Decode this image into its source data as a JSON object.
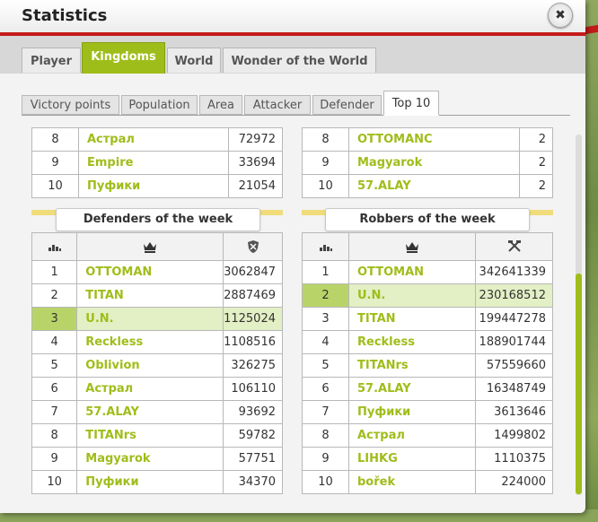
{
  "window": {
    "title": "Statistics",
    "close_symbol": "✖"
  },
  "main_tabs": [
    {
      "label": "Player",
      "active": false
    },
    {
      "label": "Kingdoms",
      "active": true
    },
    {
      "label": "World",
      "active": false
    },
    {
      "label": "Wonder of the World",
      "active": false
    }
  ],
  "sub_tabs": [
    {
      "label": "Victory points",
      "active": false
    },
    {
      "label": "Population",
      "active": false
    },
    {
      "label": "Area",
      "active": false
    },
    {
      "label": "Attacker",
      "active": false
    },
    {
      "label": "Defender",
      "active": false
    },
    {
      "label": "Top 10",
      "active": true
    }
  ],
  "upper_left_rows": [
    {
      "rank": "8",
      "name": "Астрал",
      "value": "72972"
    },
    {
      "rank": "9",
      "name": "Empire",
      "value": "33694"
    },
    {
      "rank": "10",
      "name": "Пуфики",
      "value": "21054"
    }
  ],
  "upper_right_rows": [
    {
      "rank": "8",
      "name": "OTTOMANC",
      "value": "2"
    },
    {
      "rank": "9",
      "name": "Magyarok",
      "value": "2"
    },
    {
      "rank": "10",
      "name": "57.ALAY",
      "value": "2"
    }
  ],
  "defenders": {
    "title": "Defenders of the week",
    "rows": [
      {
        "rank": "1",
        "name": "OTTOMAN",
        "value": "3062847"
      },
      {
        "rank": "2",
        "name": "TITAN",
        "value": "2887469"
      },
      {
        "rank": "3",
        "name": "U.N.",
        "value": "1125024"
      },
      {
        "rank": "4",
        "name": "Reckless",
        "value": "1108516"
      },
      {
        "rank": "5",
        "name": "Oblivion",
        "value": "326275"
      },
      {
        "rank": "6",
        "name": "Астрал",
        "value": "106110"
      },
      {
        "rank": "7",
        "name": "57.ALAY",
        "value": "93692"
      },
      {
        "rank": "8",
        "name": "TITANrs",
        "value": "59782"
      },
      {
        "rank": "9",
        "name": "Magyarok",
        "value": "57751"
      },
      {
        "rank": "10",
        "name": "Пуфики",
        "value": "34370"
      }
    ],
    "highlight_rank": "3"
  },
  "robbers": {
    "title": "Robbers of the week",
    "rows": [
      {
        "rank": "1",
        "name": "OTTOMAN",
        "value": "342641339"
      },
      {
        "rank": "2",
        "name": "U.N.",
        "value": "230168512"
      },
      {
        "rank": "3",
        "name": "TITAN",
        "value": "199447278"
      },
      {
        "rank": "4",
        "name": "Reckless",
        "value": "188901744"
      },
      {
        "rank": "5",
        "name": "TITANrs",
        "value": "57559660"
      },
      {
        "rank": "6",
        "name": "57.ALAY",
        "value": "16348749"
      },
      {
        "rank": "7",
        "name": "Пуфики",
        "value": "3613646"
      },
      {
        "rank": "8",
        "name": "Астрал",
        "value": "1499802"
      },
      {
        "rank": "9",
        "name": "LIHKG",
        "value": "1110375"
      },
      {
        "rank": "10",
        "name": "bořek",
        "value": "224000"
      }
    ],
    "highlight_rank": "2"
  },
  "icons": {
    "rank_column": "rank-bars-icon",
    "name_column": "crown-icon",
    "defender_value_column": "shield-icon",
    "robber_value_column": "crossed-tools-icon"
  },
  "colors": {
    "accent": "#9fbd1a",
    "highlight": "#e3efc4",
    "close_red": "#c41a1a"
  }
}
